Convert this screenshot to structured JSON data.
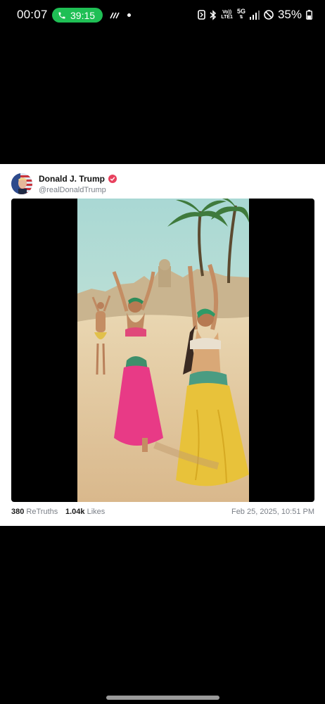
{
  "status_bar": {
    "time": "00:07",
    "call_timer": "39:15",
    "network_volte": "Vo))",
    "network_lte": "LTE1",
    "network_5g": "5G",
    "battery_percent": "35%"
  },
  "post": {
    "display_name": "Donald J. Trump",
    "handle": "@realDonaldTrump",
    "retruths_count": "380",
    "retruths_label": "ReTruths",
    "likes_count": "1.04k",
    "likes_label": "Likes",
    "timestamp": "Feb 25, 2025, 10:51 PM",
    "verified_color": "#e8415e"
  },
  "icons": {
    "call": "phone-icon",
    "wifi_calling": "wifi-calling-icon",
    "nfc": "nfc-icon",
    "bluetooth": "bluetooth-icon",
    "signal": "signal-icon",
    "dnd": "do-not-disturb-icon",
    "battery": "battery-icon"
  }
}
